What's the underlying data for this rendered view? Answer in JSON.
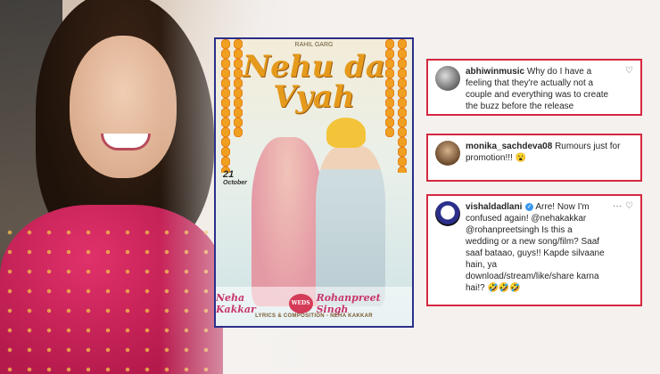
{
  "poster": {
    "credit_top": "RAHIL GARG",
    "title_line1": "Nehu da",
    "title_line2": "Vyah",
    "date_day": "21",
    "date_month": "October",
    "name_left": "Neha Kakkar",
    "weds": "WEDS",
    "name_right": "Rohanpreet Singh",
    "credit_bottom": "LYRICS & COMPOSITION - NEHA KAKKAR"
  },
  "comments": [
    {
      "username": "abhiwinmusic",
      "text": "Why do I have a feeling that they're actually not a couple and everything was to create the buzz before the release",
      "verified": false
    },
    {
      "username": "monika_sachdeva08",
      "text": "Rumours just for promotion!!! 😮",
      "verified": false
    },
    {
      "username": "vishaldadlani",
      "text": "Arre! Now I'm confused again! @nehakakkar @rohanpreetsingh Is this a wedding or a new song/film? Saaf saaf bataao, guys!! Kapde silvaane hain, ya download/stream/like/share karna hai!? 🤣🤣🤣",
      "verified": true
    }
  ],
  "icons": {
    "heart": "heart-icon",
    "more": "more-icon",
    "verified": "verified-badge-icon"
  },
  "colors": {
    "highlight_border": "#d6273f",
    "poster_border": "#2b2f8a",
    "title_orange": "#e59a1c"
  }
}
